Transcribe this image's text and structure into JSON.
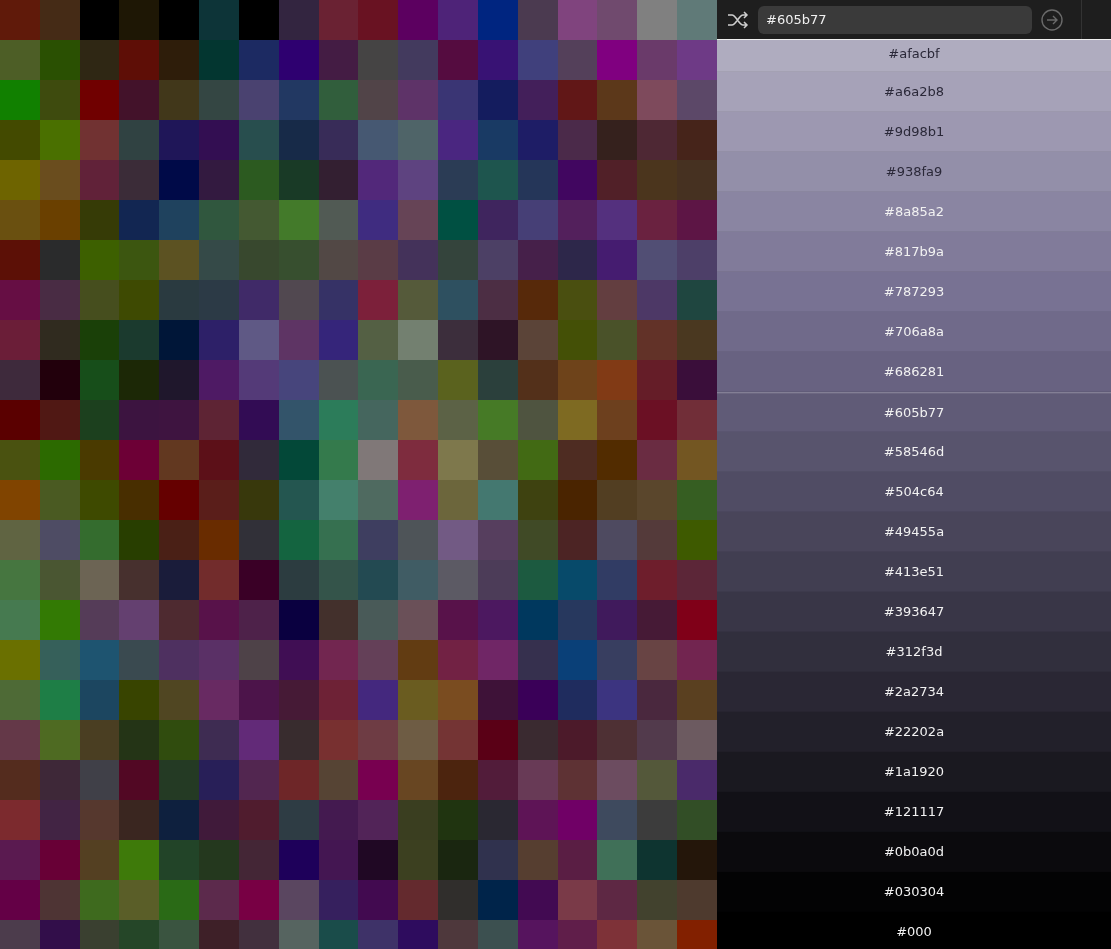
{
  "palette": {
    "rows": [
      {
        "swatches": [
          {
            "color": "#601a0a"
          },
          {
            "color": "#452b16"
          },
          {
            "color": "#000000"
          },
          {
            "color": "#1e1705"
          },
          {
            "color": "#000000"
          },
          {
            "color": "#0d3438"
          },
          {
            "color": "#000000"
          },
          {
            "color": "#332540"
          },
          {
            "color": "#6a2233"
          },
          {
            "color": "#691222"
          },
          {
            "color": "#5c0060"
          },
          {
            "color": "#4e2378"
          },
          {
            "color": "#002580"
          },
          {
            "color": "#4b3a50"
          },
          {
            "color": "#80447e"
          },
          {
            "color": "#704a6e"
          },
          {
            "color": "#808080"
          },
          {
            "color": "#607a78"
          }
        ]
      },
      {
        "swatches": [
          {
            "color": "#4d5e26"
          },
          {
            "color": "#2a5002"
          },
          {
            "color": "#2f2714"
          },
          {
            "color": "#5e0e06"
          },
          {
            "color": "#2e1d0a"
          },
          {
            "color": "#033630"
          },
          {
            "color": "#1c2a62"
          },
          {
            "color": "#2e0070"
          },
          {
            "color": "#441c44"
          },
          {
            "color": "#454444"
          },
          {
            "color": "#433a5e"
          },
          {
            "color": "#550c40"
          },
          {
            "color": "#381274"
          },
          {
            "color": "#40407c"
          },
          {
            "color": "#54405a"
          },
          {
            "color": "#800080"
          },
          {
            "color": "#6a3a6a"
          },
          {
            "color": "#6e3a86"
          }
        ]
      },
      {
        "swatches": [
          {
            "color": "#118000"
          },
          {
            "color": "#3e4b0e"
          },
          {
            "color": "#700000"
          },
          {
            "color": "#43122a"
          },
          {
            "color": "#41371a"
          },
          {
            "color": "#344643"
          },
          {
            "color": "#4a4270"
          },
          {
            "color": "#223862"
          },
          {
            "color": "#315e3c"
          },
          {
            "color": "#514448"
          },
          {
            "color": "#5e3368"
          },
          {
            "color": "#3a3574"
          },
          {
            "color": "#141c5e"
          },
          {
            "color": "#431f5a"
          },
          {
            "color": "#611717"
          },
          {
            "color": "#5c381a"
          },
          {
            "color": "#7e4a5c"
          },
          {
            "color": "#5c4868"
          }
        ]
      },
      {
        "swatches": [
          {
            "color": "#434a00"
          },
          {
            "color": "#4a7000"
          },
          {
            "color": "#713232"
          },
          {
            "color": "#304242"
          },
          {
            "color": "#1f1658"
          },
          {
            "color": "#330e52"
          },
          {
            "color": "#284e4e"
          },
          {
            "color": "#172a48"
          },
          {
            "color": "#382c58"
          },
          {
            "color": "#465872"
          },
          {
            "color": "#4f6468"
          },
          {
            "color": "#4a2680"
          },
          {
            "color": "#193a64"
          },
          {
            "color": "#1e1d66"
          },
          {
            "color": "#4b2a4a"
          },
          {
            "color": "#35211d"
          },
          {
            "color": "#4e2834"
          },
          {
            "color": "#46241a"
          }
        ]
      },
      {
        "swatches": [
          {
            "color": "#6e6400"
          },
          {
            "color": "#6a4d1e"
          },
          {
            "color": "#612239"
          },
          {
            "color": "#3b2c38"
          },
          {
            "color": "#000a48"
          },
          {
            "color": "#331a40"
          },
          {
            "color": "#2c5a20"
          },
          {
            "color": "#193a26"
          },
          {
            "color": "#331f31"
          },
          {
            "color": "#52287a"
          },
          {
            "color": "#5e4380"
          },
          {
            "color": "#2b3c55"
          },
          {
            "color": "#1e554e"
          },
          {
            "color": "#253659"
          },
          {
            "color": "#410660"
          },
          {
            "color": "#512028"
          },
          {
            "color": "#4b351d"
          },
          {
            "color": "#463121"
          }
        ]
      },
      {
        "swatches": [
          {
            "color": "#6a5010"
          },
          {
            "color": "#6a4000"
          },
          {
            "color": "#363b06"
          },
          {
            "color": "#122652"
          },
          {
            "color": "#1f425e"
          },
          {
            "color": "#30573e"
          },
          {
            "color": "#445932"
          },
          {
            "color": "#437a2a"
          },
          {
            "color": "#515a54"
          },
          {
            "color": "#3f2c80"
          },
          {
            "color": "#664456"
          },
          {
            "color": "#005042"
          },
          {
            "color": "#3f255e"
          },
          {
            "color": "#463f76"
          },
          {
            "color": "#53205c"
          },
          {
            "color": "#54307e"
          },
          {
            "color": "#6a2240"
          },
          {
            "color": "#5d1545"
          }
        ]
      },
      {
        "swatches": [
          {
            "color": "#5c1006"
          },
          {
            "color": "#2a2b2c"
          },
          {
            "color": "#3d6000"
          },
          {
            "color": "#3c5610"
          },
          {
            "color": "#5c5222"
          },
          {
            "color": "#354a48"
          },
          {
            "color": "#38482e"
          },
          {
            "color": "#374f2f"
          },
          {
            "color": "#524845"
          },
          {
            "color": "#5a3c46"
          },
          {
            "color": "#44325a"
          },
          {
            "color": "#34443c"
          },
          {
            "color": "#4c4065"
          },
          {
            "color": "#46204a"
          },
          {
            "color": "#2d274a"
          },
          {
            "color": "#451c70"
          },
          {
            "color": "#514e74"
          },
          {
            "color": "#4d3f68"
          }
        ]
      },
      {
        "swatches": [
          {
            "color": "#660e44"
          },
          {
            "color": "#492c44"
          },
          {
            "color": "#464e1e"
          },
          {
            "color": "#3e4a02"
          },
          {
            "color": "#2a3a40"
          },
          {
            "color": "#2c3a46"
          },
          {
            "color": "#402a68"
          },
          {
            "color": "#514850"
          },
          {
            "color": "#363266"
          },
          {
            "color": "#7c203a"
          },
          {
            "color": "#555a3a"
          },
          {
            "color": "#2e5060"
          },
          {
            "color": "#4c2e44"
          },
          {
            "color": "#57290a"
          },
          {
            "color": "#4a4f10"
          },
          {
            "color": "#633e40"
          },
          {
            "color": "#4d3866"
          },
          {
            "color": "#1f4640"
          }
        ]
      },
      {
        "swatches": [
          {
            "color": "#6b1e38"
          },
          {
            "color": "#302b1f"
          },
          {
            "color": "#1a4008"
          },
          {
            "color": "#1b3a2e"
          },
          {
            "color": "#001638"
          },
          {
            "color": "#2d2068"
          },
          {
            "color": "#5f5985"
          },
          {
            "color": "#5e3464"
          },
          {
            "color": "#35257a"
          },
          {
            "color": "#546044"
          },
          {
            "color": "#738070"
          },
          {
            "color": "#3c2e3c"
          },
          {
            "color": "#2e1426"
          },
          {
            "color": "#5b4438"
          },
          {
            "color": "#445006"
          },
          {
            "color": "#4a5229"
          },
          {
            "color": "#623228"
          },
          {
            "color": "#4a3820"
          }
        ]
      },
      {
        "swatches": [
          {
            "color": "#3e2a3c"
          },
          {
            "color": "#22000c"
          },
          {
            "color": "#174e1a"
          },
          {
            "color": "#1c2806"
          },
          {
            "color": "#1f172c"
          },
          {
            "color": "#4e1a64"
          },
          {
            "color": "#543a78"
          },
          {
            "color": "#47457c"
          },
          {
            "color": "#4b5252"
          },
          {
            "color": "#3a6652"
          },
          {
            "color": "#495c4c"
          },
          {
            "color": "#5a621e"
          },
          {
            "color": "#2b403c"
          },
          {
            "color": "#53301a"
          },
          {
            "color": "#6e431a"
          },
          {
            "color": "#813a15"
          },
          {
            "color": "#651d28"
          },
          {
            "color": "#3a0e3a"
          }
        ]
      },
      {
        "swatches": [
          {
            "color": "#5a0000"
          },
          {
            "color": "#501814"
          },
          {
            "color": "#1c401e"
          },
          {
            "color": "#3c1440"
          },
          {
            "color": "#3e1440"
          },
          {
            "color": "#5e2434"
          },
          {
            "color": "#320c54"
          },
          {
            "color": "#33546a"
          },
          {
            "color": "#2c7c5a"
          },
          {
            "color": "#45665e"
          },
          {
            "color": "#7e583c"
          },
          {
            "color": "#5c6246"
          },
          {
            "color": "#467a26"
          },
          {
            "color": "#4f5440"
          },
          {
            "color": "#7e6a22"
          },
          {
            "color": "#6d401e"
          },
          {
            "color": "#6b1024"
          },
          {
            "color": "#712e38"
          }
        ]
      },
      {
        "swatches": [
          {
            "color": "#4a5210"
          },
          {
            "color": "#2c6a00"
          },
          {
            "color": "#4a3a00"
          },
          {
            "color": "#6d0036"
          },
          {
            "color": "#623820"
          },
          {
            "color": "#5c1018"
          },
          {
            "color": "#312a3a"
          },
          {
            "color": "#034838"
          },
          {
            "color": "#347a4c"
          },
          {
            "color": "#807878"
          },
          {
            "color": "#7e2c3e"
          },
          {
            "color": "#7e784c"
          },
          {
            "color": "#584e38"
          },
          {
            "color": "#426a14"
          },
          {
            "color": "#4e2c22"
          },
          {
            "color": "#522c00"
          },
          {
            "color": "#6a2c42"
          },
          {
            "color": "#735622"
          }
        ]
      },
      {
        "swatches": [
          {
            "color": "#804400"
          },
          {
            "color": "#4a5a22"
          },
          {
            "color": "#3e4a00"
          },
          {
            "color": "#482e00"
          },
          {
            "color": "#650000"
          },
          {
            "color": "#5a1e1a"
          },
          {
            "color": "#38380c"
          },
          {
            "color": "#245650"
          },
          {
            "color": "#44806c"
          },
          {
            "color": "#4f6a60"
          },
          {
            "color": "#7e2070"
          },
          {
            "color": "#6c663c"
          },
          {
            "color": "#447870"
          },
          {
            "color": "#3e4210"
          },
          {
            "color": "#4a2400"
          },
          {
            "color": "#523e22"
          },
          {
            "color": "#5a462c"
          },
          {
            "color": "#365e22"
          }
        ]
      },
      {
        "swatches": [
          {
            "color": "#606442"
          },
          {
            "color": "#4e4c64"
          },
          {
            "color": "#346c2e"
          },
          {
            "color": "#283e00"
          },
          {
            "color": "#4a2016"
          },
          {
            "color": "#692c00"
          },
          {
            "color": "#313038"
          },
          {
            "color": "#146440"
          },
          {
            "color": "#367050"
          },
          {
            "color": "#3e3e60"
          },
          {
            "color": "#4e5458"
          },
          {
            "color": "#725a84"
          },
          {
            "color": "#563e5e"
          },
          {
            "color": "#404a26"
          },
          {
            "color": "#4c2424"
          },
          {
            "color": "#4e4a60"
          },
          {
            "color": "#543a3a"
          },
          {
            "color": "#3e5a00"
          }
        ]
      },
      {
        "swatches": [
          {
            "color": "#467640"
          },
          {
            "color": "#4a5632"
          },
          {
            "color": "#6c6454"
          },
          {
            "color": "#47302e"
          },
          {
            "color": "#1a1c3a"
          },
          {
            "color": "#722c2c"
          },
          {
            "color": "#3a0026"
          },
          {
            "color": "#2c3c40"
          },
          {
            "color": "#34544a"
          },
          {
            "color": "#234a52"
          },
          {
            "color": "#405c64"
          },
          {
            "color": "#5c5a64"
          },
          {
            "color": "#4c3c58"
          },
          {
            "color": "#1c5a40"
          },
          {
            "color": "#074a6a"
          },
          {
            "color": "#313c64"
          },
          {
            "color": "#6e1e2c"
          },
          {
            "color": "#5c2638"
          }
        ]
      },
      {
        "swatches": [
          {
            "color": "#467a50"
          },
          {
            "color": "#337a04"
          },
          {
            "color": "#553c58"
          },
          {
            "color": "#644070"
          },
          {
            "color": "#4e2a30"
          },
          {
            "color": "#58124a"
          },
          {
            "color": "#4e224a"
          },
          {
            "color": "#0a0040"
          },
          {
            "color": "#43302c"
          },
          {
            "color": "#495a58"
          },
          {
            "color": "#6a5058"
          },
          {
            "color": "#58124a"
          },
          {
            "color": "#4c1860"
          },
          {
            "color": "#00385e"
          },
          {
            "color": "#27385e"
          },
          {
            "color": "#401a5c"
          },
          {
            "color": "#461a36"
          },
          {
            "color": "#800018"
          }
        ]
      },
      {
        "swatches": [
          {
            "color": "#6a7000"
          },
          {
            "color": "#36605a"
          },
          {
            "color": "#1e5470"
          },
          {
            "color": "#3a4a50"
          },
          {
            "color": "#4e3060"
          },
          {
            "color": "#5a3066"
          },
          {
            "color": "#4e4248"
          },
          {
            "color": "#400e54"
          },
          {
            "color": "#722650"
          },
          {
            "color": "#644058"
          },
          {
            "color": "#623c12"
          },
          {
            "color": "#722244"
          },
          {
            "color": "#702666"
          },
          {
            "color": "#36304e"
          },
          {
            "color": "#0a4078"
          },
          {
            "color": "#383e60"
          },
          {
            "color": "#684444"
          },
          {
            "color": "#722550"
          }
        ]
      },
      {
        "swatches": [
          {
            "color": "#4e6a36"
          },
          {
            "color": "#1e7e46"
          },
          {
            "color": "#1c4660"
          },
          {
            "color": "#384400"
          },
          {
            "color": "#504622"
          },
          {
            "color": "#682a62"
          },
          {
            "color": "#4c144a"
          },
          {
            "color": "#461a36"
          },
          {
            "color": "#6e2236"
          },
          {
            "color": "#44287e"
          },
          {
            "color": "#6a5c20"
          },
          {
            "color": "#7a4c20"
          },
          {
            "color": "#3e1238"
          },
          {
            "color": "#3a0058"
          },
          {
            "color": "#1f2c5e"
          },
          {
            "color": "#3c3480"
          },
          {
            "color": "#4a283e"
          },
          {
            "color": "#5a4020"
          }
        ]
      },
      {
        "swatches": [
          {
            "color": "#643848"
          },
          {
            "color": "#4e6a22"
          },
          {
            "color": "#4a3e22"
          },
          {
            "color": "#243416"
          },
          {
            "color": "#304c0e"
          },
          {
            "color": "#3e2c52"
          },
          {
            "color": "#622a78"
          },
          {
            "color": "#382c2e"
          },
          {
            "color": "#783030"
          },
          {
            "color": "#6e3c44"
          },
          {
            "color": "#6e5c44"
          },
          {
            "color": "#743434"
          },
          {
            "color": "#5a0016"
          },
          {
            "color": "#3a2a30"
          },
          {
            "color": "#4c1a2a"
          },
          {
            "color": "#4e3034"
          },
          {
            "color": "#523a4c"
          },
          {
            "color": "#6c5a60"
          }
        ]
      },
      {
        "swatches": [
          {
            "color": "#542c1e"
          },
          {
            "color": "#3e2838"
          },
          {
            "color": "#404048"
          },
          {
            "color": "#520824"
          },
          {
            "color": "#243a24"
          },
          {
            "color": "#281f58"
          },
          {
            "color": "#522650"
          },
          {
            "color": "#6e2628"
          },
          {
            "color": "#564434"
          },
          {
            "color": "#780050"
          },
          {
            "color": "#684622"
          },
          {
            "color": "#4c240e"
          },
          {
            "color": "#521c3a"
          },
          {
            "color": "#683a56"
          },
          {
            "color": "#5e3234"
          },
          {
            "color": "#6c4c60"
          },
          {
            "color": "#54583a"
          },
          {
            "color": "#4a2a6a"
          }
        ]
      },
      {
        "swatches": [
          {
            "color": "#7c2a2e"
          },
          {
            "color": "#422444"
          },
          {
            "color": "#56382e"
          },
          {
            "color": "#3a2620"
          },
          {
            "color": "#0e203e"
          },
          {
            "color": "#401a3a"
          },
          {
            "color": "#501c2e"
          },
          {
            "color": "#2e3c44"
          },
          {
            "color": "#441a50"
          },
          {
            "color": "#522458"
          },
          {
            "color": "#3a3e20"
          },
          {
            "color": "#203410"
          },
          {
            "color": "#2a2832"
          },
          {
            "color": "#5e1456"
          },
          {
            "color": "#700066"
          },
          {
            "color": "#3e4a5e"
          },
          {
            "color": "#3c3c3c"
          },
          {
            "color": "#324e26"
          }
        ]
      },
      {
        "swatches": [
          {
            "color": "#5a1a50"
          },
          {
            "color": "#680036"
          },
          {
            "color": "#544022"
          },
          {
            "color": "#3e7a0a"
          },
          {
            "color": "#224428"
          },
          {
            "color": "#24381e"
          },
          {
            "color": "#442636"
          },
          {
            "color": "#1e005a"
          },
          {
            "color": "#441652"
          },
          {
            "color": "#200824"
          },
          {
            "color": "#3c4020"
          },
          {
            "color": "#1a2610"
          },
          {
            "color": "#30324e"
          },
          {
            "color": "#563e30"
          },
          {
            "color": "#5a1e44"
          },
          {
            "color": "#407058"
          },
          {
            "color": "#0e3430"
          },
          {
            "color": "#24160a"
          }
        ]
      },
      {
        "swatches": [
          {
            "color": "#640046"
          },
          {
            "color": "#4e3434"
          },
          {
            "color": "#3e6a1e"
          },
          {
            "color": "#5a5e28"
          },
          {
            "color": "#2a6a16"
          },
          {
            "color": "#5c2a4c"
          },
          {
            "color": "#780044"
          },
          {
            "color": "#5a4660"
          },
          {
            "color": "#36205e"
          },
          {
            "color": "#420a50"
          },
          {
            "color": "#642a2e"
          },
          {
            "color": "#302e2c"
          },
          {
            "color": "#00244a"
          },
          {
            "color": "#420a52"
          },
          {
            "color": "#7a3a48"
          },
          {
            "color": "#5e2844"
          },
          {
            "color": "#42422e"
          },
          {
            "color": "#4e3a2e"
          }
        ]
      },
      {
        "swatches": [
          {
            "color": "#4c3c4c"
          },
          {
            "color": "#320e4a"
          },
          {
            "color": "#3a4030"
          },
          {
            "color": "#254628"
          },
          {
            "color": "#3a5440"
          },
          {
            "color": "#3e2028"
          },
          {
            "color": "#42303e"
          },
          {
            "color": "#566460"
          },
          {
            "color": "#1a4c4a"
          },
          {
            "color": "#3e3268"
          },
          {
            "color": "#2e0c5e"
          },
          {
            "color": "#4e383c"
          },
          {
            "color": "#3c5050"
          },
          {
            "color": "#56145e"
          },
          {
            "color": "#601e4a"
          },
          {
            "color": "#7e3238"
          },
          {
            "color": "#6a5438"
          },
          {
            "color": "#822000"
          }
        ]
      }
    ]
  },
  "generator": {
    "color_input": {
      "value": "#605b77"
    },
    "shades": [
      {
        "label": "#afacbf",
        "color": "#afacbf",
        "selected": false
      },
      {
        "label": "#a6a2b8",
        "color": "#a6a2b8",
        "selected": false
      },
      {
        "label": "#9d98b1",
        "color": "#9d98b1",
        "selected": false
      },
      {
        "label": "#938fa9",
        "color": "#938fa9",
        "selected": false
      },
      {
        "label": "#8a85a2",
        "color": "#8a85a2",
        "selected": false
      },
      {
        "label": "#817b9a",
        "color": "#817b9a",
        "selected": false
      },
      {
        "label": "#787293",
        "color": "#787293",
        "selected": false
      },
      {
        "label": "#706a8a",
        "color": "#706a8a",
        "selected": false
      },
      {
        "label": "#686281",
        "color": "#686281",
        "selected": false
      },
      {
        "label": "#605b77",
        "color": "#605b77",
        "selected": true
      },
      {
        "label": "#58546d",
        "color": "#58546d",
        "selected": false
      },
      {
        "label": "#504c64",
        "color": "#504c64",
        "selected": false
      },
      {
        "label": "#49455a",
        "color": "#49455a",
        "selected": false
      },
      {
        "label": "#413e51",
        "color": "#413e51",
        "selected": false
      },
      {
        "label": "#393647",
        "color": "#393647",
        "selected": false
      },
      {
        "label": "#312f3d",
        "color": "#312f3d",
        "selected": false
      },
      {
        "label": "#2a2734",
        "color": "#2a2734",
        "selected": false
      },
      {
        "label": "#22202a",
        "color": "#22202a",
        "selected": false
      },
      {
        "label": "#1a1920",
        "color": "#1a1920",
        "selected": false
      },
      {
        "label": "#121117",
        "color": "#121117",
        "selected": false
      },
      {
        "label": "#0b0a0d",
        "color": "#0b0a0d",
        "selected": false
      },
      {
        "label": "#030304",
        "color": "#030304",
        "selected": false
      },
      {
        "label": "#000",
        "color": "#000000",
        "selected": false
      }
    ]
  }
}
